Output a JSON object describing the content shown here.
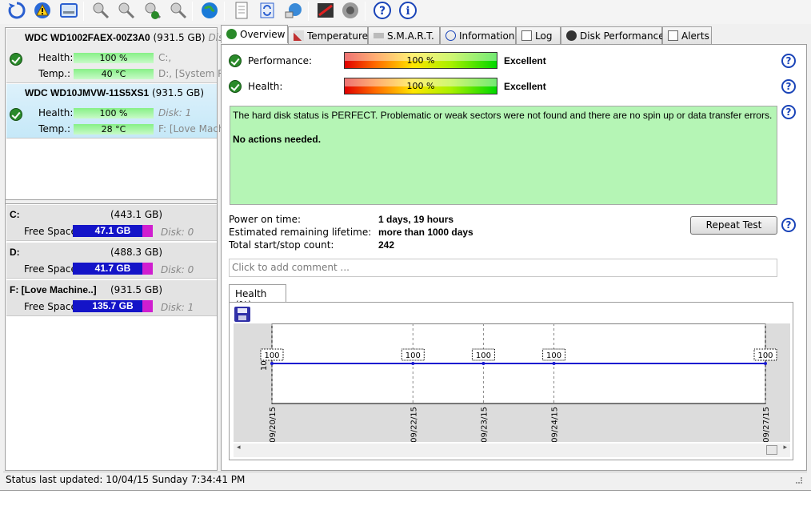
{
  "disks": [
    {
      "model": "WDC WD1002FAEX-00Z3A0",
      "size": "(931.5 GB)",
      "tag": "Disk",
      "health_label": "Health:",
      "health": "100 %",
      "temp_label": "Temp.:",
      "temp": "40 °C",
      "drive1": "C:,",
      "drive2": "D:, [System R"
    },
    {
      "model": "WDC WD10JMVW-11S5XS1",
      "size": "(931.5 GB)",
      "health_label": "Health:",
      "health": "100 %",
      "temp_label": "Temp.:",
      "temp": "28 °C",
      "drive1": "Disk: 1",
      "drive2": "F: [Love Mach"
    }
  ],
  "volumes": [
    {
      "name": "C:",
      "size": "(443.1 GB)",
      "free_label": "Free Space",
      "free": "47.1 GB",
      "disk": "Disk: 0"
    },
    {
      "name": "D:",
      "size": "(488.3 GB)",
      "free_label": "Free Space",
      "free": "41.7 GB",
      "disk": "Disk: 0"
    },
    {
      "name": "F: [Love Machine..]",
      "size": "(931.5 GB)",
      "free_label": "Free Space",
      "free": "135.7 GB",
      "disk": "Disk: 1"
    }
  ],
  "tabs": [
    "Overview",
    "Temperature",
    "S.M.A.R.T.",
    "Information",
    "Log",
    "Disk Performance",
    "Alerts"
  ],
  "overview": {
    "performance_label": "Performance:",
    "performance_value": "100 %",
    "performance_rating": "Excellent",
    "health_label": "Health:",
    "health_value": "100 %",
    "health_rating": "Excellent",
    "status_text": "The hard disk status is PERFECT. Problematic or weak sectors were not found and there are no spin up or data transfer errors.",
    "status_action": "No actions needed.",
    "power_on_label": "Power on time:",
    "power_on_value": "1 days, 19 hours",
    "lifetime_label": "Estimated remaining lifetime:",
    "lifetime_value": "more than 1000 days",
    "startstop_label": "Total start/stop count:",
    "startstop_value": "242",
    "repeat_button": "Repeat Test",
    "comment_placeholder": "Click to add comment ...",
    "chart_tab": "Health (%)"
  },
  "chart_data": {
    "type": "line",
    "x": [
      "09/20/15",
      "09/22/15",
      "09/23/15",
      "09/24/15",
      "09/27/15"
    ],
    "values": [
      100,
      100,
      100,
      100,
      100
    ],
    "y_tick": "100",
    "color": "#1a1ad0"
  },
  "statusbar": {
    "text": "Status last updated: 10/04/15 Sunday 7:34:41 PM"
  },
  "colors": {
    "accent": "#1a44b8",
    "good": "#2a8a2a",
    "status_bg": "#b5f5b5"
  }
}
